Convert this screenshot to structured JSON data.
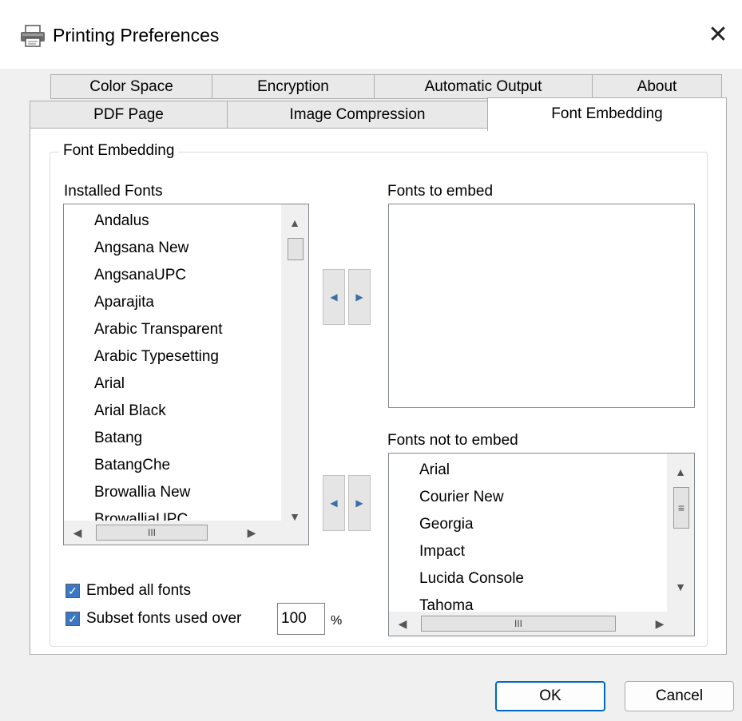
{
  "window": {
    "title": "Printing Preferences",
    "icon": "printer-icon",
    "close_glyph": "✕"
  },
  "tabs": {
    "row1": [
      "Color Space",
      "Encryption",
      "Automatic Output",
      "About"
    ],
    "row2": [
      "PDF Page",
      "Image Compression",
      "Font Embedding"
    ],
    "active": "Font Embedding"
  },
  "font_embedding": {
    "group_label": "Font Embedding",
    "installed_label": "Installed Fonts",
    "installed_fonts": [
      "Andalus",
      "Angsana New",
      "AngsanaUPC",
      "Aparajita",
      "Arabic Transparent",
      "Arabic Typesetting",
      "Arial",
      "Arial Black",
      "Batang",
      "BatangChe",
      "Browallia New",
      "BrowalliaUPC"
    ],
    "embed_label": "Fonts to embed",
    "embed_fonts": [],
    "not_embed_label": "Fonts not to embed",
    "not_embed_fonts": [
      "Arial",
      "Courier New",
      "Georgia",
      "Impact",
      "Lucida Console",
      "Tahoma"
    ],
    "embed_all": {
      "label": "Embed all fonts",
      "checked": true
    },
    "subset": {
      "label": "Subset fonts used over",
      "checked": true,
      "value": "100",
      "unit": "%"
    }
  },
  "scroll_glyphs": {
    "up": "▲",
    "down": "▼",
    "left": "◀",
    "right": "▶",
    "thumb_h": "III",
    "thumb_v": "≡",
    "move_left": "◀",
    "move_right": "▶"
  },
  "buttons": {
    "ok": "OK",
    "cancel": "Cancel"
  },
  "colors": {
    "accent": "#0067c0",
    "checkbox_fill": "#3b78c4"
  }
}
